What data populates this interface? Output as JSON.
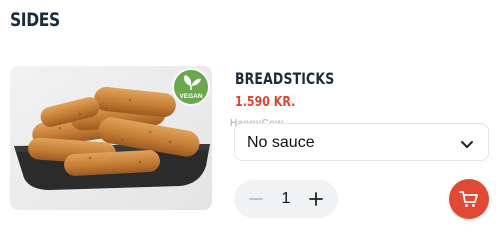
{
  "section": {
    "title": "SIDES"
  },
  "product": {
    "name": "BREADSTICKS",
    "price": "1.590 KR.",
    "badge": "VEGAN",
    "image_alt": "breadsticks-photo"
  },
  "watermark": "HappyCow",
  "sauce_select": {
    "selected": "No sauce",
    "icon": "chevron-down-icon"
  },
  "quantity": {
    "value": "1",
    "minus_icon": "minus-icon",
    "plus_icon": "plus-icon"
  },
  "cart": {
    "icon": "cart-icon"
  },
  "colors": {
    "accent": "#e04a35",
    "price": "#d6472f",
    "title": "#1e2b3a",
    "vegan_badge": "#6aa84f"
  }
}
